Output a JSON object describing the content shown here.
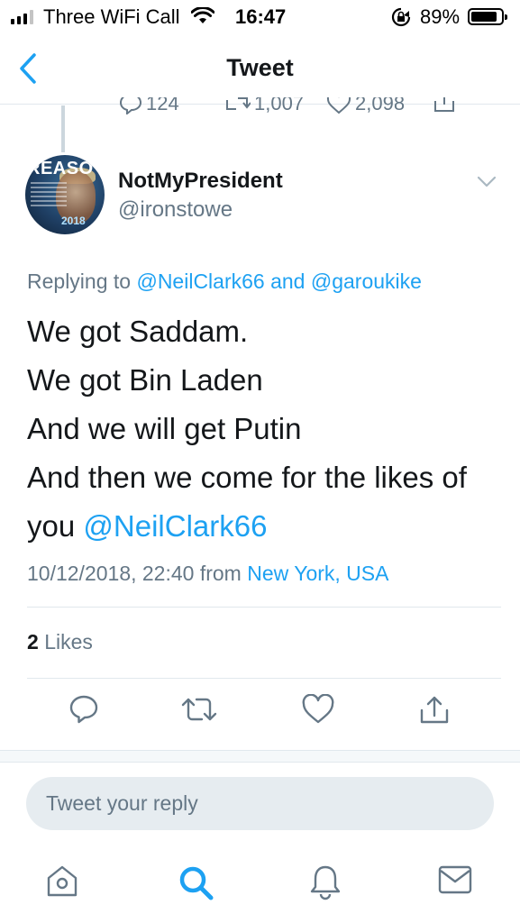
{
  "status_bar": {
    "carrier": "Three WiFi Call",
    "time": "16:47",
    "battery_percent": "89%",
    "battery_level": 0.89,
    "signal_bars_active": 3,
    "signal_bars_total": 4
  },
  "nav": {
    "title": "Tweet",
    "back_icon": "chevron-left-icon"
  },
  "previous_tweet": {
    "reply_count": "124",
    "retweet_count": "1,007",
    "like_count": "2,098"
  },
  "tweet": {
    "author": {
      "display_name": "NotMyPresident",
      "handle": "@ironstowe",
      "avatar_text": "REASO",
      "avatar_year": "2018"
    },
    "replying_prefix": "Replying to",
    "replying_to_1": "@NeilClark66",
    "replying_and": "and",
    "replying_to_2": "@garoukike",
    "text_lines": [
      "We got Saddam.",
      "We got Bin Laden",
      "And we will get Putin",
      "And then we come for the likes of"
    ],
    "text_last_prefix": "you",
    "text_last_mention": "@NeilClark66",
    "timestamp": "10/12/2018, 22:40",
    "from_label": "from",
    "location": "New York, USA",
    "likes_count": "2",
    "likes_label": "Likes"
  },
  "reply": {
    "placeholder": "Tweet your reply"
  },
  "tab_bar": {
    "items": [
      "home-icon",
      "search-icon",
      "notifications-icon",
      "messages-icon"
    ],
    "active": "search-icon"
  },
  "colors": {
    "accent": "#1da1f2",
    "secondary_text": "#657786",
    "divider": "#e1e8ed"
  }
}
